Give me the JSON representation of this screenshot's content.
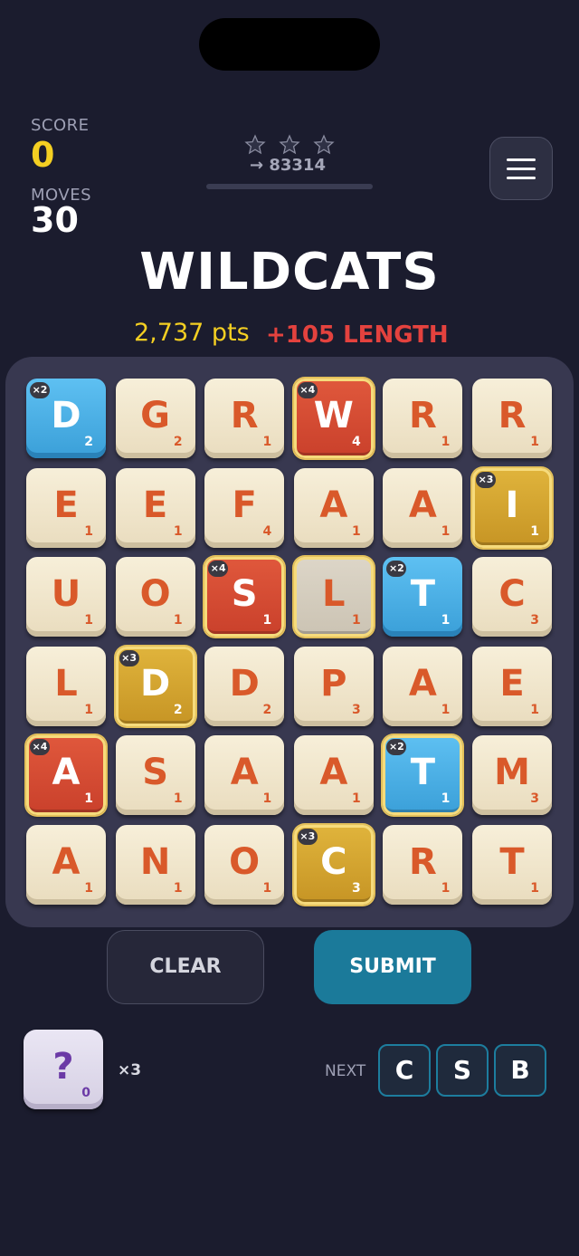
{
  "header": {
    "score_label": "SCORE",
    "score_value": "0",
    "moves_label": "MOVES",
    "moves_value": "30",
    "target_text": "→ 83314",
    "stars_earned": 0,
    "stars_total": 3,
    "progress": 0
  },
  "current_word": {
    "word": "WILDCATS",
    "points": "2,737 pts",
    "bonus": "+105 LENGTH"
  },
  "board": [
    [
      {
        "l": "D",
        "v": "2",
        "t": "blue",
        "m": "×2"
      },
      {
        "l": "G",
        "v": "2"
      },
      {
        "l": "R",
        "v": "1"
      },
      {
        "l": "W",
        "v": "4",
        "t": "red",
        "m": "×4",
        "sel": true
      },
      {
        "l": "R",
        "v": "1"
      },
      {
        "l": "R",
        "v": "1"
      }
    ],
    [
      {
        "l": "E",
        "v": "1"
      },
      {
        "l": "E",
        "v": "1"
      },
      {
        "l": "F",
        "v": "4"
      },
      {
        "l": "A",
        "v": "1"
      },
      {
        "l": "A",
        "v": "1"
      },
      {
        "l": "I",
        "v": "1",
        "t": "gold",
        "m": "×3",
        "sel": true
      }
    ],
    [
      {
        "l": "U",
        "v": "1"
      },
      {
        "l": "O",
        "v": "1"
      },
      {
        "l": "S",
        "v": "1",
        "t": "red",
        "m": "×4",
        "sel": true
      },
      {
        "l": "L",
        "v": "1",
        "t": "gray",
        "sel": true
      },
      {
        "l": "T",
        "v": "1",
        "t": "blue",
        "m": "×2"
      },
      {
        "l": "C",
        "v": "3"
      }
    ],
    [
      {
        "l": "L",
        "v": "1"
      },
      {
        "l": "D",
        "v": "2",
        "t": "gold",
        "m": "×3",
        "sel": true
      },
      {
        "l": "D",
        "v": "2"
      },
      {
        "l": "P",
        "v": "3"
      },
      {
        "l": "A",
        "v": "1"
      },
      {
        "l": "E",
        "v": "1"
      }
    ],
    [
      {
        "l": "A",
        "v": "1",
        "t": "red",
        "m": "×4",
        "sel": true
      },
      {
        "l": "S",
        "v": "1"
      },
      {
        "l": "A",
        "v": "1"
      },
      {
        "l": "A",
        "v": "1"
      },
      {
        "l": "T",
        "v": "1",
        "t": "blue",
        "m": "×2",
        "sel": true
      },
      {
        "l": "M",
        "v": "3"
      }
    ],
    [
      {
        "l": "A",
        "v": "1"
      },
      {
        "l": "N",
        "v": "1"
      },
      {
        "l": "O",
        "v": "1"
      },
      {
        "l": "C",
        "v": "3",
        "t": "gold",
        "m": "×3",
        "sel": true
      },
      {
        "l": "R",
        "v": "1"
      },
      {
        "l": "T",
        "v": "1"
      }
    ]
  ],
  "actions": {
    "clear_label": "CLEAR",
    "submit_label": "SUBMIT"
  },
  "wildcard": {
    "symbol": "?",
    "value": "0",
    "count": "×3"
  },
  "next": {
    "label": "NEXT",
    "tiles": [
      "C",
      "S",
      "B"
    ]
  },
  "colors": {
    "background": "#1b1c2e",
    "score": "#f4cf22",
    "bonus": "#e4423e",
    "submit": "#1b7a9a"
  }
}
